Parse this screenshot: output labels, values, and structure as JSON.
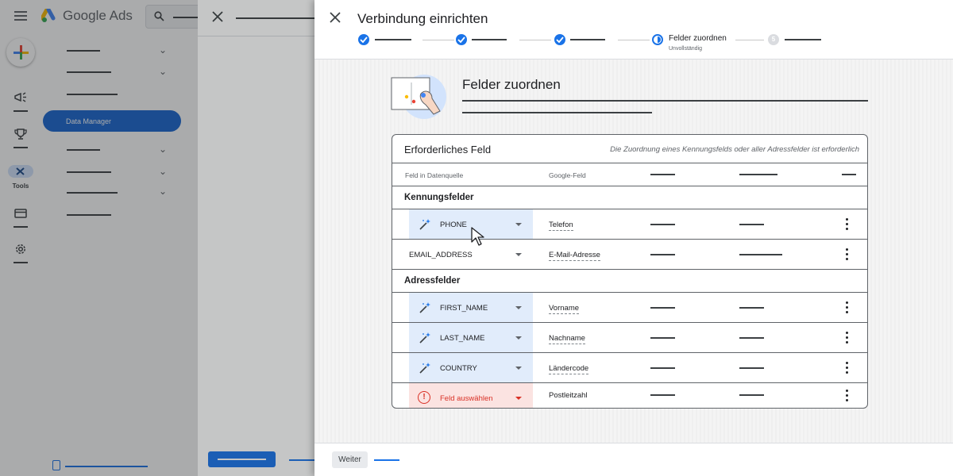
{
  "app": {
    "product_name": "Google Ads",
    "nav_active_item": "Data Manager",
    "rail_tools_label": "Tools"
  },
  "dialog": {
    "title": "Verbindung einrichten",
    "stepper": {
      "current_label": "Felder zuordnen",
      "current_status": "Unvollständig",
      "next_step_number": "5"
    },
    "section_title": "Felder zuordnen",
    "card": {
      "title": "Erforderliches Feld",
      "note": "Die Zuordnung eines Kennungsfelds oder aller Adressfelder ist erforderlich",
      "col_source": "Feld in Datenquelle",
      "col_google": "Google-Feld",
      "groups": [
        {
          "label": "Kennungsfelder",
          "rows": [
            {
              "source": "PHONE",
              "google": "Telefon",
              "state": "auto"
            },
            {
              "source": "EMAIL_ADDRESS",
              "google": "E-Mail-Adresse",
              "state": "plain"
            }
          ]
        },
        {
          "label": "Adressfelder",
          "rows": [
            {
              "source": "FIRST_NAME",
              "google": "Vorname",
              "state": "auto"
            },
            {
              "source": "LAST_NAME",
              "google": "Nachname",
              "state": "auto"
            },
            {
              "source": "COUNTRY",
              "google": "Ländercode",
              "state": "auto"
            },
            {
              "source": "Feld auswählen",
              "google": "Postleitzahl",
              "state": "error"
            }
          ]
        }
      ]
    },
    "footer_button": "Weiter"
  },
  "colors": {
    "primary": "#1a73e8",
    "error": "#d93025",
    "auto_fill": "#e1ecfb",
    "error_fill": "#fbe3e1"
  }
}
